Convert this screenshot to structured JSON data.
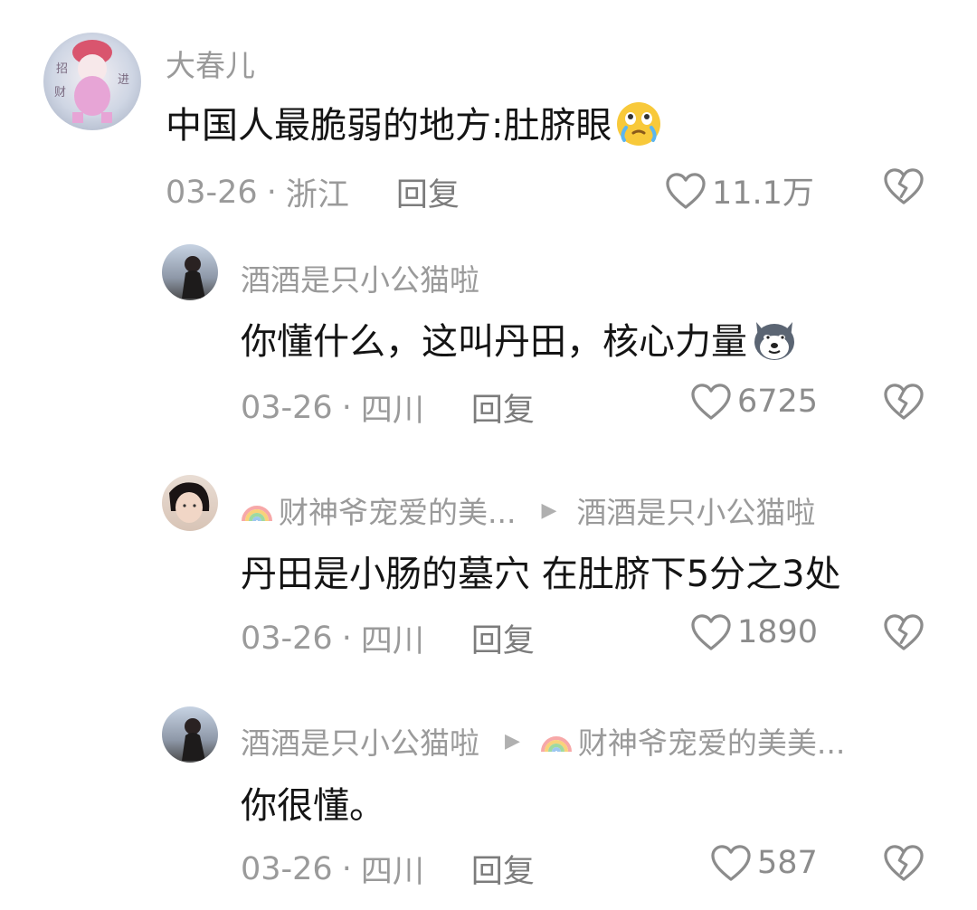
{
  "comments": [
    {
      "user": "大春儿",
      "reply_to": "",
      "text": "中国人最脆弱的地方:肚脐眼",
      "emoji": "crying-laugh-emoji",
      "date": "03-26",
      "location": "浙江",
      "reply_label": "回复",
      "likes": "11.1万",
      "avatar_text": [
        "招",
        "财",
        "进"
      ]
    },
    {
      "user": "酒酒是只小公猫啦",
      "reply_to": "",
      "text": "你懂什么，这叫丹田，核心力量",
      "emoji": "husky-dog-emoji",
      "date": "03-26",
      "location": "四川",
      "reply_label": "回复",
      "likes": "6725"
    },
    {
      "user": "财神爷宠爱的美...",
      "reply_to": "酒酒是只小公猫啦",
      "text": "丹田是小肠的墓穴 在肚脐下5分之3处",
      "emoji": "",
      "date": "03-26",
      "location": "四川",
      "reply_label": "回复",
      "likes": "1890"
    },
    {
      "user": "酒酒是只小公猫啦",
      "reply_to": "财神爷宠爱的美美...",
      "text": "你很懂。",
      "emoji": "",
      "date": "03-26",
      "location": "四川",
      "reply_label": "回复",
      "likes": "587"
    }
  ],
  "separator": "·",
  "icons": {
    "like": "heart-outline-icon",
    "dislike": "broken-heart-icon",
    "reply_arrow": "triangle-right-icon",
    "rainbow": "rainbow-icon"
  },
  "colors": {
    "name": "#9a9a9a",
    "text": "#141414",
    "meta": "#9a9a9a",
    "icon": "#8c8c8c"
  }
}
